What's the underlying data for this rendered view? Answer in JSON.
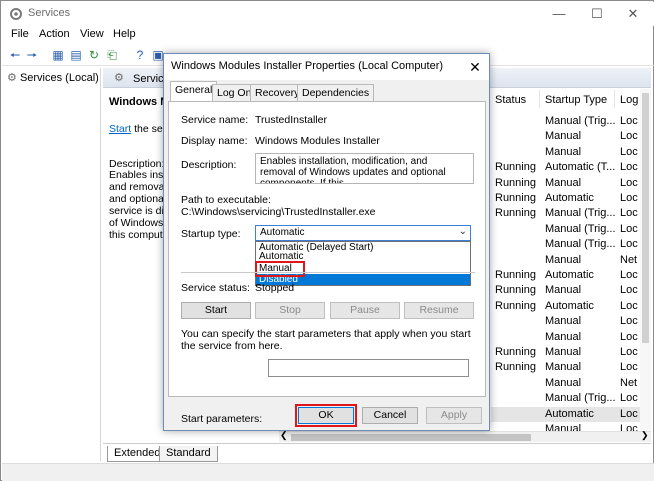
{
  "window": {
    "title": "Services"
  },
  "menu": [
    "File",
    "Action",
    "View",
    "Help"
  ],
  "tree": {
    "item": "Services (Local)"
  },
  "main": {
    "header": "Services",
    "service_title": "Windows Mo",
    "start_link": "Start",
    "start_rest": " the servi",
    "description_label": "Description:",
    "description_lines": [
      "Enables insta",
      "and removal",
      "and optional",
      "service is disa",
      "of Windows",
      "this compute"
    ],
    "columns": {
      "status": "Status",
      "startup": "Startup Type",
      "logon": "Log"
    },
    "rows": [
      {
        "status": "",
        "startup": "Manual (Trig...",
        "logon": "Loc"
      },
      {
        "status": "",
        "startup": "Manual",
        "logon": "Loc"
      },
      {
        "status": "",
        "startup": "Manual",
        "logon": "Loc"
      },
      {
        "status": "Running",
        "startup": "Automatic (T...",
        "logon": "Loc"
      },
      {
        "status": "Running",
        "startup": "Manual",
        "logon": "Loc"
      },
      {
        "status": "Running",
        "startup": "Automatic",
        "logon": "Loc"
      },
      {
        "status": "Running",
        "startup": "Manual (Trig...",
        "logon": "Loc"
      },
      {
        "status": "",
        "startup": "Manual (Trig...",
        "logon": "Loc"
      },
      {
        "status": "",
        "startup": "Manual (Trig...",
        "logon": "Loc"
      },
      {
        "status": "",
        "startup": "Manual",
        "logon": "Net"
      },
      {
        "status": "Running",
        "startup": "Automatic",
        "logon": "Loc"
      },
      {
        "status": "Running",
        "startup": "Manual",
        "logon": "Loc"
      },
      {
        "status": "Running",
        "startup": "Automatic",
        "logon": "Loc"
      },
      {
        "status": "",
        "startup": "Manual",
        "logon": "Loc"
      },
      {
        "status": "",
        "startup": "Manual",
        "logon": "Loc"
      },
      {
        "status": "Running",
        "startup": "Manual",
        "logon": "Loc"
      },
      {
        "status": "Running",
        "startup": "Manual",
        "logon": "Loc"
      },
      {
        "status": "",
        "startup": "Manual",
        "logon": "Net"
      },
      {
        "status": "",
        "startup": "Manual (Trig...",
        "logon": "Loc"
      },
      {
        "status": "",
        "startup": "Automatic",
        "logon": "Loc"
      },
      {
        "status": "",
        "startup": "Manual",
        "logon": "Loc"
      }
    ],
    "tabs": [
      "Extended",
      "Standard"
    ]
  },
  "dialog": {
    "title": "Windows Modules Installer Properties (Local Computer)",
    "tabs": [
      "General",
      "Log On",
      "Recovery",
      "Dependencies"
    ],
    "service_name_label": "Service name:",
    "service_name": "TrustedInstaller",
    "display_name_label": "Display name:",
    "display_name": "Windows Modules Installer",
    "description_label": "Description:",
    "description": "Enables installation, modification, and removal of Windows updates and optional components. If this",
    "path_label": "Path to executable:",
    "path": "C:\\Windows\\servicing\\TrustedInstaller.exe",
    "startup_label": "Startup type:",
    "startup_value": "Automatic",
    "startup_options": [
      "Automatic (Delayed Start)",
      "Automatic",
      "Manual",
      "Disabled"
    ],
    "status_label": "Service status:",
    "status_value": "Stopped",
    "buttons": {
      "start": "Start",
      "stop": "Stop",
      "pause": "Pause",
      "resume": "Resume"
    },
    "hint": "You can specify the start parameters that apply when you start the service from here.",
    "params_label": "Start parameters:",
    "ok": "OK",
    "cancel": "Cancel",
    "apply": "Apply"
  },
  "colors": {
    "highlight": "#0078d7",
    "callout": "#e0161b",
    "link": "#0066cc"
  }
}
